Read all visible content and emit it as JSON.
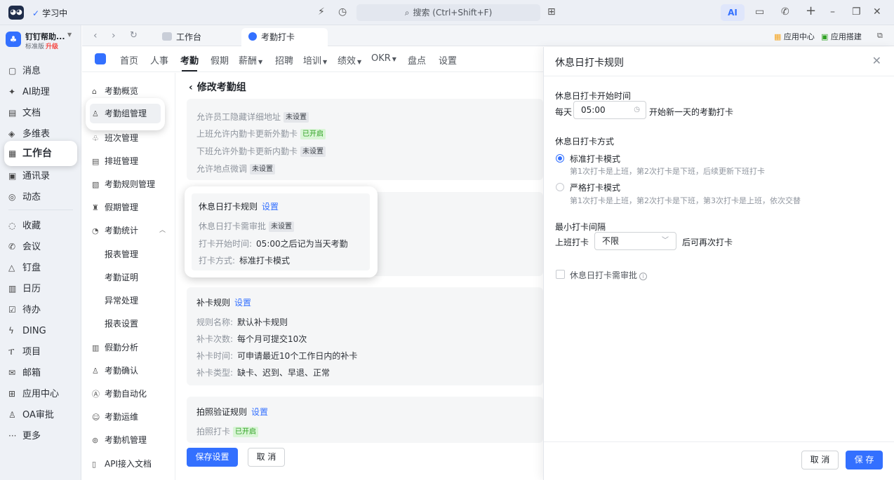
{
  "titlebar": {
    "status": "学习中",
    "search_placeholder": "搜索 (Ctrl+Shift+F)",
    "ai_label": "AI"
  },
  "org": {
    "name": "钉钉帮助...",
    "edition": "标准版",
    "upgrade": "升级"
  },
  "leftnav": {
    "items": [
      {
        "label": "消息",
        "icon": "message-icon"
      },
      {
        "label": "AI助理",
        "icon": "ai-assistant-icon"
      },
      {
        "label": "文档",
        "icon": "document-icon"
      },
      {
        "label": "多维表",
        "icon": "table-icon"
      },
      {
        "label": "工作台",
        "icon": "workbench-icon"
      },
      {
        "label": "通讯录",
        "icon": "contacts-icon"
      },
      {
        "label": "动态",
        "icon": "moments-icon"
      },
      {
        "label": "收藏",
        "icon": "favorite-icon"
      },
      {
        "label": "会议",
        "icon": "meeting-icon"
      },
      {
        "label": "钉盘",
        "icon": "drive-icon"
      },
      {
        "label": "日历",
        "icon": "calendar-icon"
      },
      {
        "label": "待办",
        "icon": "todo-icon"
      },
      {
        "label": "DING",
        "icon": "ding-icon"
      },
      {
        "label": "项目",
        "icon": "project-icon"
      },
      {
        "label": "邮箱",
        "icon": "mail-icon"
      },
      {
        "label": "应用中心",
        "icon": "app-center-icon"
      },
      {
        "label": "OA审批",
        "icon": "approval-icon"
      },
      {
        "label": "更多",
        "icon": "more-icon"
      }
    ]
  },
  "tabs": {
    "items": [
      {
        "label": "工作台"
      },
      {
        "label": "考勤打卡"
      }
    ],
    "app_center": "应用中心",
    "app_builder": "应用搭建"
  },
  "modnav": {
    "items": [
      "首页",
      "人事",
      "考勤",
      "假期",
      "薪酬",
      "招聘",
      "培训",
      "绩效",
      "OKR",
      "盘点",
      "设置"
    ]
  },
  "attmenu": {
    "items": [
      {
        "label": "考勤概览"
      },
      {
        "label": "考勤组管理"
      },
      {
        "label": "班次管理"
      },
      {
        "label": "排班管理"
      },
      {
        "label": "考勤规则管理"
      },
      {
        "label": "假期管理"
      },
      {
        "label": "考勤统计"
      },
      {
        "label": "报表管理"
      },
      {
        "label": "考勤证明"
      },
      {
        "label": "异常处理"
      },
      {
        "label": "报表设置"
      },
      {
        "label": "假勤分析"
      },
      {
        "label": "考勤确认"
      },
      {
        "label": "考勤自动化"
      },
      {
        "label": "考勤运维"
      },
      {
        "label": "考勤机管理"
      },
      {
        "label": "API接入文档"
      }
    ]
  },
  "main": {
    "title": "修改考勤组",
    "top_rows": [
      {
        "label": "允许员工隐藏详细地址",
        "tag": "未设置"
      },
      {
        "label": "上班允许内勤卡更新外勤卡",
        "tag": "已开启"
      },
      {
        "label": "下班允许外勤卡更新内勤卡",
        "tag": "未设置"
      },
      {
        "label": "允许地点微调",
        "tag": "未设置"
      }
    ],
    "rest": {
      "title": "休息日打卡规则",
      "link": "设置",
      "approval_label": "休息日打卡需审批",
      "approval_tag": "未设置",
      "start_label": "打卡开始时间:",
      "start_value": "05:00之后记为当天考勤",
      "mode_label": "打卡方式:",
      "mode_value": "标准打卡模式"
    },
    "makeup": {
      "title": "补卡规则",
      "link": "设置",
      "rows": [
        {
          "label": "规则名称:",
          "value": "默认补卡规则"
        },
        {
          "label": "补卡次数:",
          "value": "每个月可提交10次"
        },
        {
          "label": "补卡时间:",
          "value": "可申请最近10个工作日内的补卡"
        },
        {
          "label": "补卡类型:",
          "value": "缺卡、迟到、早退、正常"
        }
      ]
    },
    "photo": {
      "title": "拍照验证规则",
      "link": "设置",
      "row_label": "拍照打卡",
      "row_tag": "已开启"
    },
    "save": "保存设置",
    "cancel": "取 消"
  },
  "drawer": {
    "title": "休息日打卡规则",
    "start_section": "休息日打卡开始时间",
    "every_day": "每天",
    "time_value": "05:00",
    "start_suffix": "开始新一天的考勤打卡",
    "mode_section": "休息日打卡方式",
    "mode_standard": "标准打卡模式",
    "mode_standard_desc": "第1次打卡是上班，第2次打卡是下班，后续更新下班打卡",
    "mode_strict": "严格打卡模式",
    "mode_strict_desc": "第1次打卡是上班，第2次打卡是下班，第3次打卡是上班，依次交替",
    "interval_section": "最小打卡间隔",
    "onduty": "上班打卡",
    "interval_value": "不限",
    "interval_suffix": "后可再次打卡",
    "approval": "休息日打卡需审批",
    "cancel": "取 消",
    "save": "保 存"
  },
  "colors": {
    "accent": "#3370ff",
    "tag_green": "#2ea121"
  }
}
